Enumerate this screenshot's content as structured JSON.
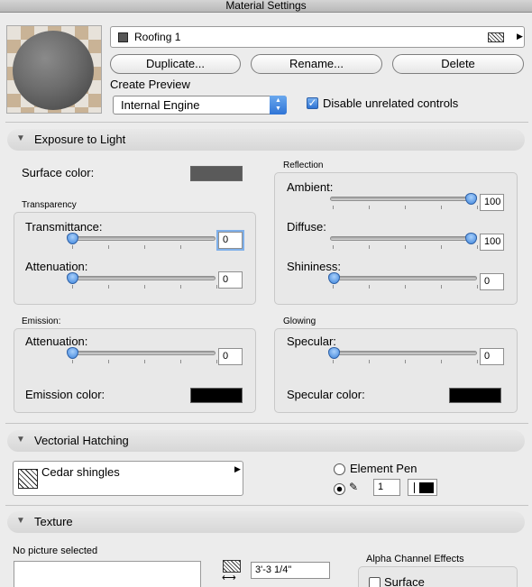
{
  "window": {
    "title": "Material Settings"
  },
  "material": {
    "name": "Roofing 1"
  },
  "buttons": {
    "duplicate": "Duplicate...",
    "rename": "Rename...",
    "delete": "Delete"
  },
  "preview": {
    "label": "Create Preview",
    "engine": "Internal Engine",
    "disable_label": "Disable unrelated controls",
    "disable_checked": true
  },
  "exposure": {
    "header": "Exposure to Light",
    "surface_color_label": "Surface color:",
    "surface_color": "#5a5a5a",
    "transparency": {
      "title": "Transparency",
      "transmittance_label": "Transmittance:",
      "transmittance_value": "0",
      "attenuation_label": "Attenuation:",
      "attenuation_value": "0"
    },
    "reflection": {
      "title": "Reflection",
      "ambient_label": "Ambient:",
      "ambient_value": "100",
      "diffuse_label": "Diffuse:",
      "diffuse_value": "100",
      "shininess_label": "Shininess:",
      "shininess_value": "0"
    },
    "emission": {
      "title": "Emission:",
      "attenuation_label": "Attenuation:",
      "attenuation_value": "0",
      "color_label": "Emission color:",
      "color": "#000000"
    },
    "glowing": {
      "title": "Glowing",
      "specular_label": "Specular:",
      "specular_value": "0",
      "color_label": "Specular color:",
      "color": "#000000"
    }
  },
  "hatching": {
    "header": "Vectorial Hatching",
    "pattern": "Cedar shingles",
    "element_pen_label": "Element Pen",
    "pen_number": "1",
    "selected": "custom"
  },
  "texture": {
    "header": "Texture",
    "no_picture": "No picture selected",
    "size_value": "3'-3 1/4\"",
    "alpha_title": "Alpha Channel Effects",
    "surface_label": "Surface"
  }
}
